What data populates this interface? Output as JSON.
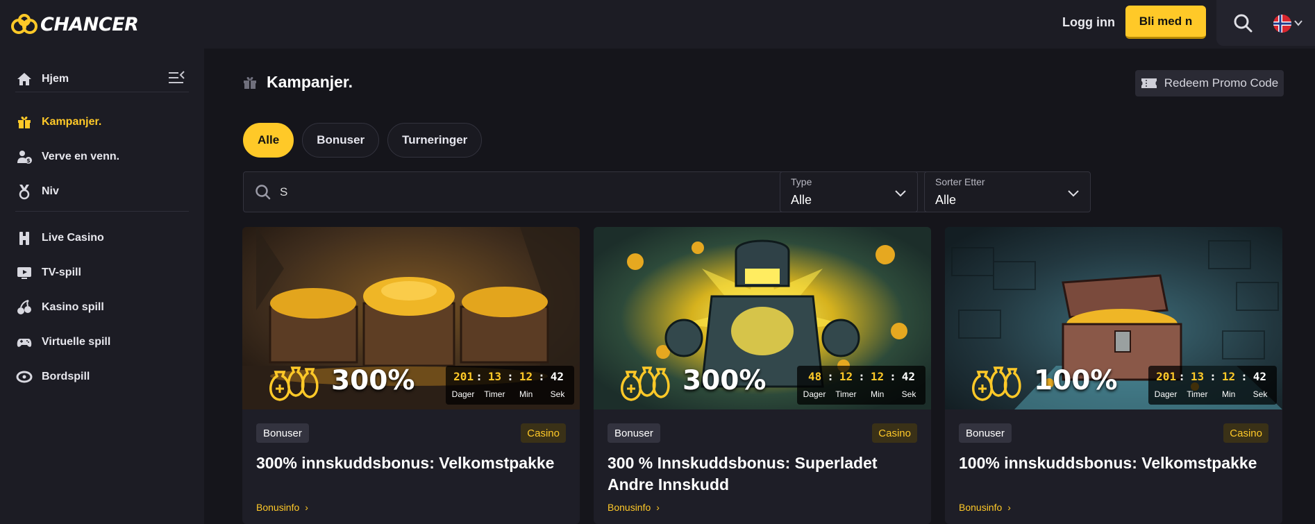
{
  "header": {
    "logo_text": "CHANCER",
    "login_label": "Logg inn",
    "join_label": "Bli med n"
  },
  "sidebar": {
    "items": [
      {
        "label": "Hjem",
        "icon": "home-icon"
      },
      {
        "label": "Kampanjer.",
        "icon": "gift-icon",
        "active": true
      },
      {
        "label": "Verve en venn.",
        "icon": "refer-friend-icon"
      },
      {
        "label": "Niv",
        "icon": "medal-icon"
      },
      {
        "label": "Live Casino",
        "icon": "live-dealer-icon"
      },
      {
        "label": "TV-spill",
        "icon": "tv-icon"
      },
      {
        "label": "Kasino spill",
        "icon": "cherries-icon"
      },
      {
        "label": "Virtuelle spill",
        "icon": "gamepad-icon"
      },
      {
        "label": "Bordspill",
        "icon": "table-games-icon"
      }
    ]
  },
  "main": {
    "title": "Kampanjer.",
    "promo_button": "Redeem Promo Code",
    "tabs": [
      {
        "label": "Alle",
        "active": true
      },
      {
        "label": "Bonuser"
      },
      {
        "label": "Turneringer"
      }
    ],
    "search": {
      "value": "S"
    },
    "type_filter": {
      "label": "Type",
      "value": "Alle"
    },
    "sort_filter": {
      "label": "Sorter Etter",
      "value": "Alle"
    }
  },
  "timer_labels": [
    "Dager",
    "Timer",
    "Min",
    "Sek"
  ],
  "cards": [
    {
      "percent": "300%",
      "timer": [
        "201",
        "13",
        "12",
        "42"
      ],
      "type_tag": "Bonuser",
      "category_tag": "Casino",
      "title": "300% innskuddsbonus: Velkomstpakke",
      "link": "Bonusinfo"
    },
    {
      "percent": "300%",
      "timer": [
        "48",
        "12",
        "12",
        "42"
      ],
      "type_tag": "Bonuser",
      "category_tag": "Casino",
      "title": "300 % Innskuddsbonus: Superladet Andre Innskudd",
      "link": "Bonusinfo"
    },
    {
      "percent": "100%",
      "timer": [
        "201",
        "13",
        "12",
        "42"
      ],
      "type_tag": "Bonuser",
      "category_tag": "Casino",
      "title": "100% innskuddsbonus: Velkomstpakke",
      "link": "Bonusinfo"
    }
  ],
  "colors": {
    "accent": "#ffc928",
    "background": "#15151b",
    "sidebar": "#1c1c24",
    "card": "#1e1e27"
  }
}
